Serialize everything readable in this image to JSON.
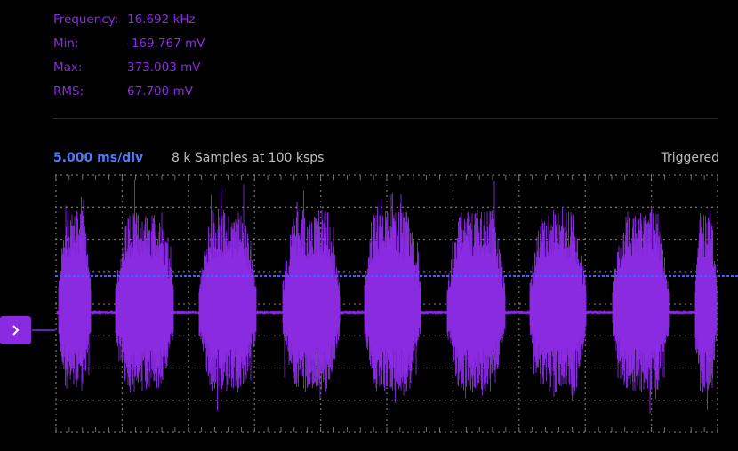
{
  "measurements": {
    "frequency": {
      "label": "Frequency:",
      "value": "16.692 kHz"
    },
    "min": {
      "label": "Min:",
      "value": "-169.767 mV"
    },
    "max": {
      "label": "Max:",
      "value": "373.003 mV"
    },
    "rms": {
      "label": "RMS:",
      "value": "67.700 mV"
    }
  },
  "status": {
    "timebase": "5.000 ms/div",
    "samples": "8 k Samples at 100 ksps",
    "trigger_state": "Triggered"
  },
  "colors": {
    "background": "#000000",
    "trace": "#8a2be2",
    "measurement_text": "#8a2be2",
    "timebase_text": "#4f7cff",
    "trigger_level_line": "#4a5bff",
    "grid_dots": "#9a9a9a",
    "status_text": "#bdbdbd"
  },
  "icons": {
    "channel_marker": "chevron-right-icon"
  }
}
